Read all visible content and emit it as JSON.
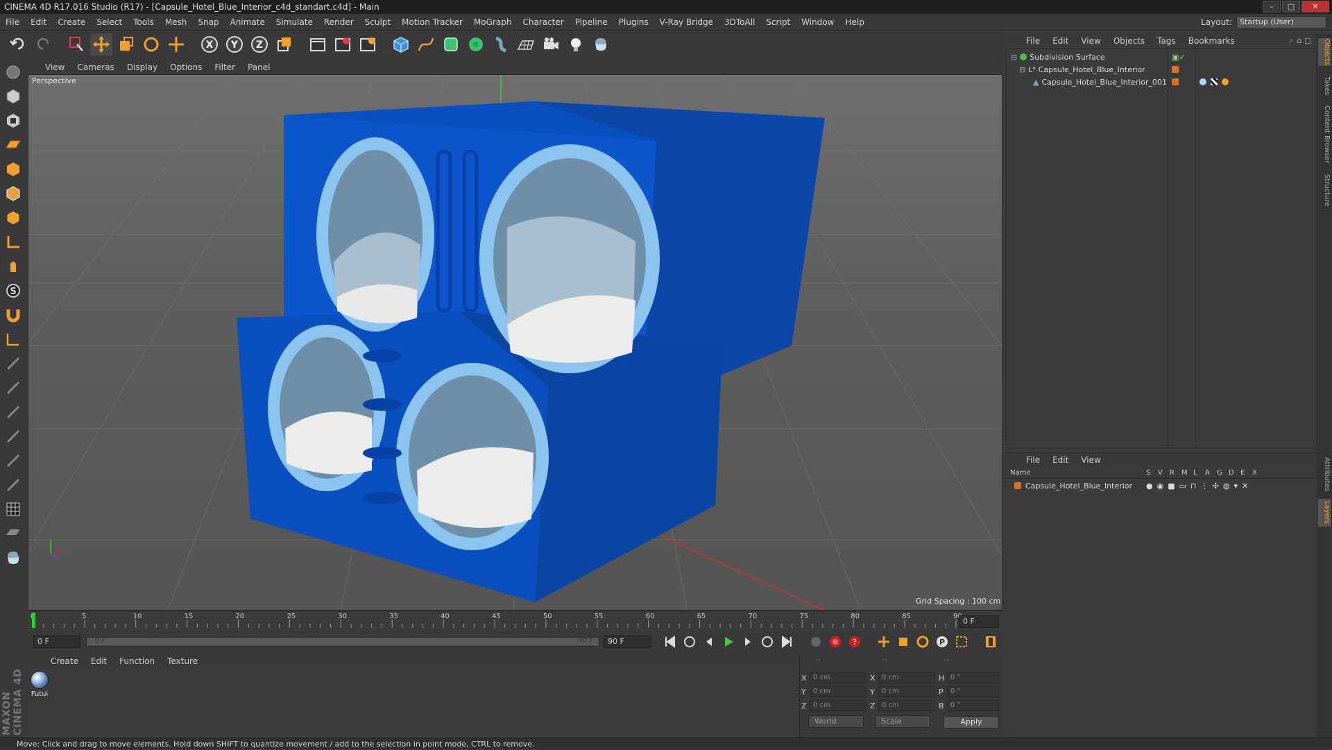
{
  "window": {
    "title": "CINEMA 4D R17.016 Studio (R17) - [Capsule_Hotel_Blue_Interior_c4d_standart.c4d] - Main"
  },
  "menubar": {
    "items": [
      "File",
      "Edit",
      "Create",
      "Select",
      "Tools",
      "Mesh",
      "Snap",
      "Animate",
      "Simulate",
      "Render",
      "Sculpt",
      "Motion Tracker",
      "MoGraph",
      "Character",
      "Pipeline",
      "Plugins",
      "V-Ray Bridge",
      "3DToAll",
      "Script",
      "Window",
      "Help"
    ],
    "layout_label": "Layout:",
    "layout_value": "Startup (User)"
  },
  "toolbar": {
    "icons": [
      "undo-icon",
      "redo-icon",
      "live-selection-icon",
      "move-icon",
      "scale-icon",
      "rotate-icon",
      "recent-tool-icon",
      "x-axis-icon",
      "y-axis-icon",
      "z-axis-icon",
      "coordinate-system-icon",
      "render-view-icon",
      "render-picture-viewer-icon",
      "edit-render-settings-icon",
      "cube-primitive-icon",
      "spline-pen-icon",
      "subdivision-surface-icon",
      "cloner-icon",
      "deformer-icon",
      "floor-icon",
      "camera-icon",
      "light-icon",
      "python-icon"
    ],
    "axis_labels": [
      "X",
      "Y",
      "Z"
    ]
  },
  "viewport": {
    "menu": [
      "View",
      "Cameras",
      "Display",
      "Options",
      "Filter",
      "Panel"
    ],
    "label": "Perspective",
    "grid_spacing": "Grid Spacing : 100 cm"
  },
  "timeline": {
    "ticks": [
      "0",
      "5",
      "10",
      "15",
      "20",
      "25",
      "30",
      "35",
      "40",
      "45",
      "50",
      "55",
      "60",
      "65",
      "70",
      "75",
      "80",
      "85",
      "90"
    ],
    "current_frame_field": "0 F",
    "start_field": "0 F",
    "range_left": "0 F",
    "range_right": "90 F",
    "end_field": "90 F"
  },
  "materials": {
    "menu": [
      "Create",
      "Edit",
      "Function",
      "Texture"
    ],
    "items": [
      {
        "name": "Futui"
      }
    ]
  },
  "coordinates": {
    "headers": [
      "--",
      "--",
      "--"
    ],
    "rows": [
      {
        "a": "X",
        "av": "0 cm",
        "b": "X",
        "bv": "0 cm",
        "c": "H",
        "cv": "0 °"
      },
      {
        "a": "Y",
        "av": "0 cm",
        "b": "Y",
        "bv": "0 cm",
        "c": "P",
        "cv": "0 °"
      },
      {
        "a": "Z",
        "av": "0 cm",
        "b": "Z",
        "bv": "0 cm",
        "c": "B",
        "cv": "0 °"
      }
    ],
    "mode1": "World",
    "mode2": "Scale",
    "apply": "Apply"
  },
  "object_manager": {
    "menu": [
      "File",
      "Edit",
      "View",
      "Objects",
      "Tags",
      "Bookmarks"
    ],
    "objects": [
      {
        "name": "Subdivision Surface",
        "color": "#4fbf4f"
      },
      {
        "name": "Capsule_Hotel_Blue_Interior",
        "color": "#e07020"
      },
      {
        "name": "Capsule_Hotel_Blue_Interior_001",
        "color": "#e07020"
      }
    ]
  },
  "layer_manager": {
    "menu": [
      "File",
      "Edit",
      "View"
    ],
    "columns": [
      "Name",
      "S",
      "V",
      "R",
      "M",
      "L",
      "A",
      "G",
      "D",
      "E",
      "X"
    ],
    "layers": [
      {
        "name": "Capsule_Hotel_Blue_Interior",
        "color": "#e07020"
      }
    ]
  },
  "side_tabs": [
    "Objects",
    "Takes",
    "Content Browser",
    "Structure",
    "Attributes",
    "Layers"
  ],
  "status": "Move: Click and drag to move elements. Hold down SHIFT to quantize movement / add to the selection in point mode, CTRL to remove.",
  "logo": "MAXON CINEMA 4D",
  "colors": {
    "accent": "#f0a030",
    "capsule_blue": "#0a4fc0",
    "capsule_trim": "#8cc4f0"
  }
}
